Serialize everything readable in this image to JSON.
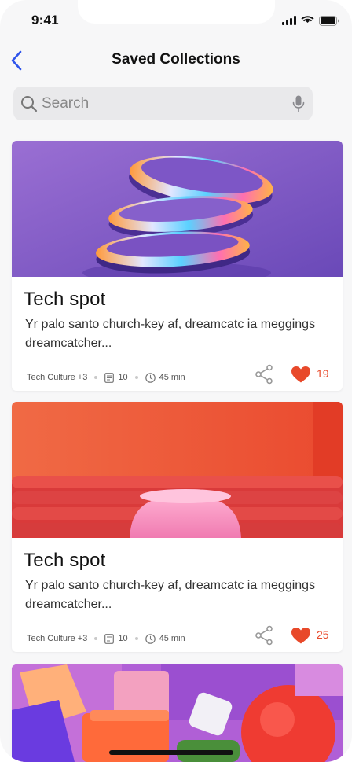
{
  "status_bar": {
    "time": "9:41"
  },
  "nav": {
    "title": "Saved Collections"
  },
  "search": {
    "placeholder": "Search"
  },
  "cards": [
    {
      "title": "Tech spot",
      "description": "Yr palo santo church-key af, dreamcatc ia meggings dreamcatcher...",
      "category": "Tech Culture +3",
      "count": "10",
      "duration": "45 min",
      "likes": "19"
    },
    {
      "title": "Tech spot",
      "description": "Yr palo santo church-key af, dreamcatc ia meggings dreamcatcher...",
      "category": "Tech Culture +3",
      "count": "10",
      "duration": "45 min",
      "likes": "25"
    }
  ],
  "colors": {
    "accent_blue": "#2f54eb",
    "like_red": "#e8492a",
    "card_1_image": "#8a63c9",
    "card_2_image": "#ee5a3c",
    "card_3_image": "#b05fd6"
  },
  "icons": [
    "back-chevron-icon",
    "search-icon",
    "microphone-icon",
    "share-icon",
    "heart-icon",
    "document-icon",
    "clock-icon",
    "signal-icon",
    "wifi-icon",
    "battery-icon"
  ]
}
